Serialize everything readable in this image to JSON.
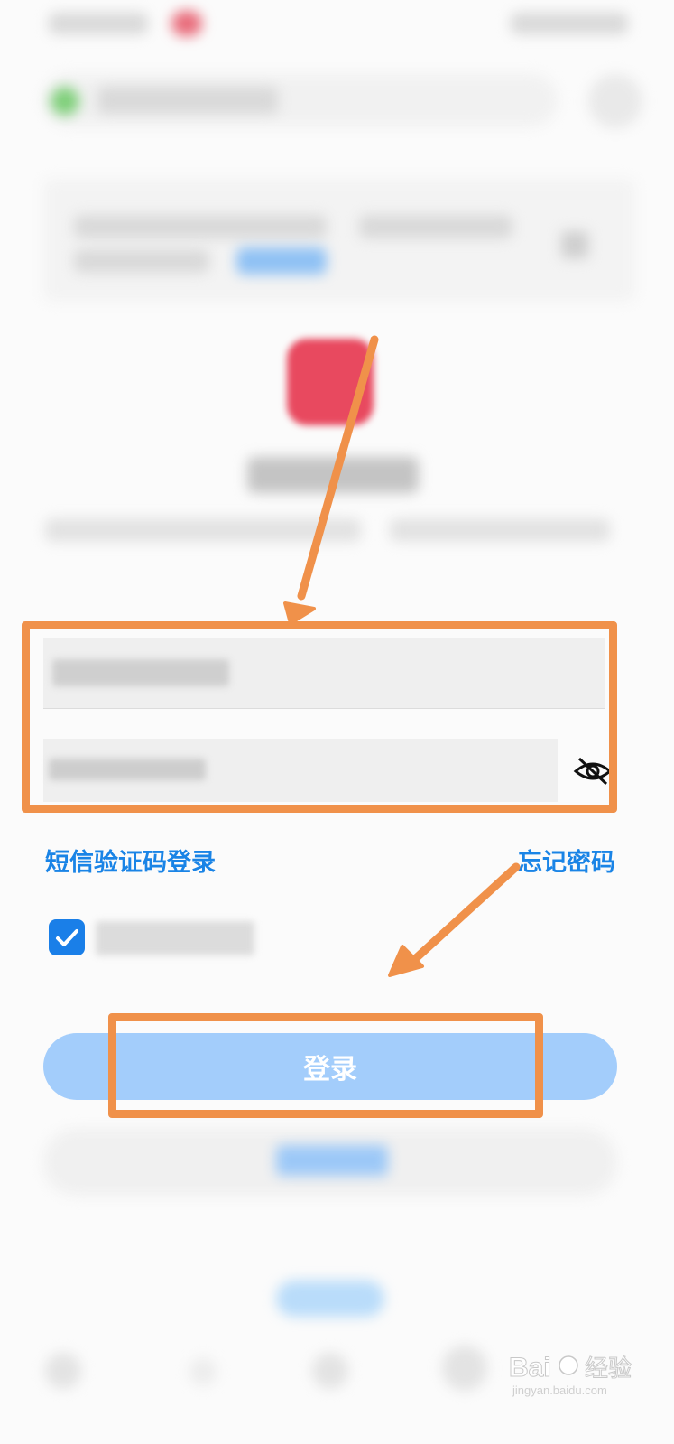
{
  "form": {
    "account_placeholder": "",
    "password_value": "",
    "sms_login_label": "短信验证码登录",
    "forgot_password_label": "忘记密码",
    "agree_checked": true
  },
  "buttons": {
    "login_label": "登录",
    "register_label": ""
  },
  "colors": {
    "link": "#1a84e6",
    "login_button": "#a3cdfb",
    "checkbox": "#1a7fe8",
    "annotation_orange": "#f0914a",
    "logo": "#e8495f"
  },
  "icons": {
    "eye_toggle": "eye-slash-icon",
    "checkbox": "check-icon"
  },
  "watermark": {
    "text_latin": "Bai",
    "text_cn": "经验",
    "url": "jingyan.baidu.com"
  }
}
